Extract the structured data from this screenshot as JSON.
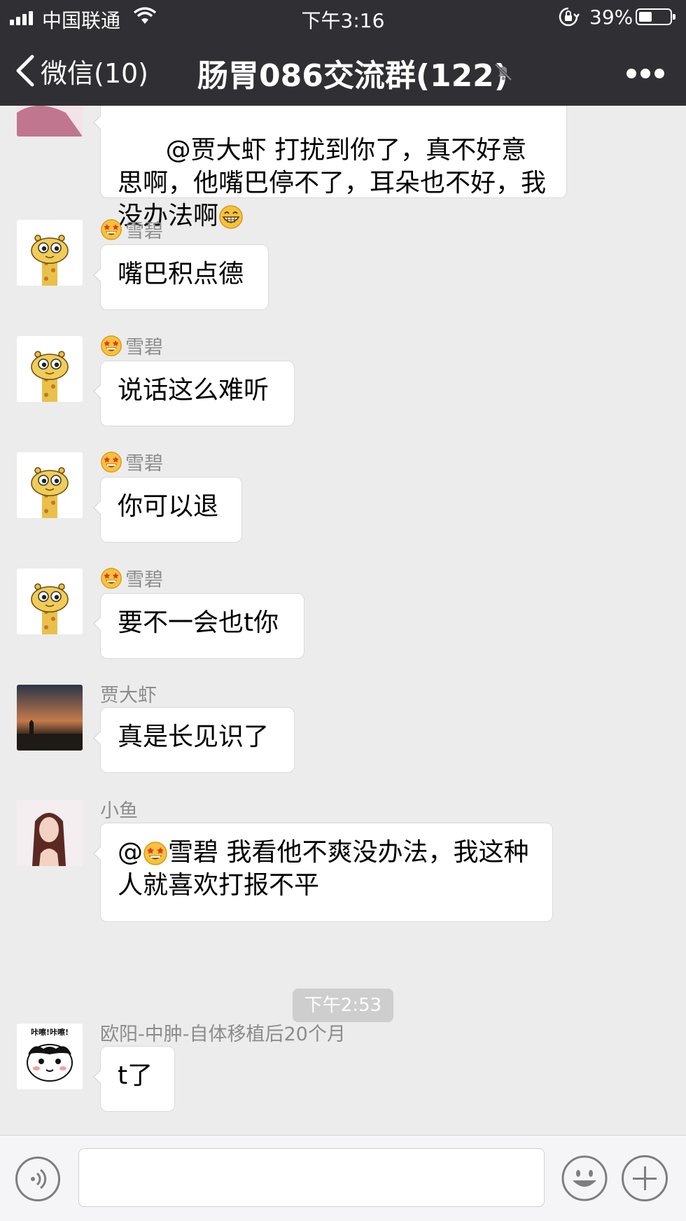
{
  "status_bar": {
    "carrier": "中国联通",
    "time": "下午3:16",
    "battery": "39%"
  },
  "nav": {
    "back_label": "微信(10)",
    "title": "肠胃086交流群(122)"
  },
  "messages": [
    {
      "sender": "",
      "text": "@贾大虾 打扰到你了，真不好意思啊，他嘴巴停不了，耳朵也不好，我没办法啊",
      "emoji": "grin-emoji"
    },
    {
      "sender": "雪碧",
      "text": "嘴巴积点德"
    },
    {
      "sender": "雪碧",
      "text": "说话这么难听"
    },
    {
      "sender": "雪碧",
      "text": "你可以退"
    },
    {
      "sender": "雪碧",
      "text": "要不一会也t你"
    },
    {
      "sender": "贾大虾",
      "text": "真是长见识了"
    },
    {
      "sender": "小鱼",
      "text_pre": "@",
      "mention": "雪碧",
      "text_post": " 我看他不爽没办法，我这种人就喜欢打报不平"
    },
    {
      "sender": "欧阳-中肿-自体移植后20个月",
      "text": "t了"
    }
  ],
  "timestamp": "下午2:53",
  "cat_avatar_text": "咔嚓!咔嚓!",
  "colors": {
    "header_bg": "#2f2f34",
    "chat_bg": "#ececec",
    "bubble_bg": "#ffffff",
    "input_bg": "#f5f5f7"
  },
  "icons": [
    "signal-icon",
    "wifi-icon",
    "rotation-lock-icon",
    "battery-icon",
    "back-chevron-icon",
    "mute-icon",
    "more-icon",
    "voice-icon",
    "emoji-icon",
    "plus-icon"
  ]
}
